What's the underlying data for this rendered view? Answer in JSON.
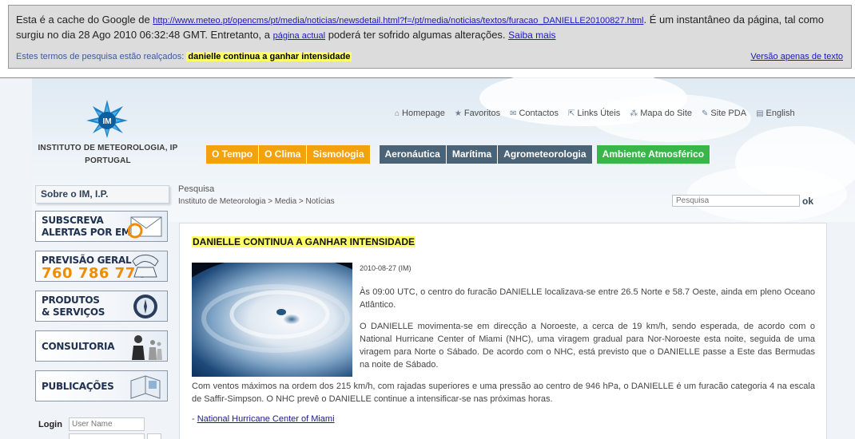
{
  "cache_banner": {
    "intro": "Esta é a cache do Google de ",
    "url": "http://www.meteo.pt/opencms/pt/media/noticias/newsdetail.html?f=/pt/media/noticias/textos/furacao_DANIELLE20100827.html",
    "text_after_url": ". É um instantâneo da página, tal como surgiu no dia 28 Ago 2010 06:32:48 GMT. Entretanto, a ",
    "current_page_link": "página actual",
    "text_after_link": " poderá ter sofrido algumas alterações. ",
    "learn_more": "Saiba mais",
    "terms_label": "Estes termos de pesquisa estão realçados: ",
    "terms_highlight": "danielle continua a ganhar intensidade",
    "text_only": "Versão apenas de texto"
  },
  "header": {
    "logo_abbr": "IM",
    "org_line1": "INSTITUTO DE METEOROLOGIA, IP",
    "org_line2": "PORTUGAL"
  },
  "top_links": [
    {
      "label": "Homepage",
      "icon": "⌂"
    },
    {
      "label": "Favoritos",
      "icon": "★"
    },
    {
      "label": "Contactos",
      "icon": "✉"
    },
    {
      "label": "Links Úteis",
      "icon": "⇱"
    },
    {
      "label": "Mapa do Site",
      "icon": "⁂"
    },
    {
      "label": "Site PDA",
      "icon": "✎"
    },
    {
      "label": "English",
      "icon": "▤"
    }
  ],
  "nav": {
    "tempo": "O Tempo",
    "clima": "O Clima",
    "sismologia": "Sismologia",
    "aeronautica": "Aeronáutica",
    "maritima": "Marítima",
    "agrometeorologia": "Agrometeorologia",
    "ambiente": "Ambiente Atmosférico"
  },
  "sidebar": {
    "about": "Sobre o IM, I.P.",
    "alerts_l1": "SUBSCREVA",
    "alerts_l2": "ALERTAS POR EMAIL",
    "forecast_l1": "PREVISÃO GERAL",
    "forecast_num": "760 786 774",
    "products_l1": "PRODUTOS",
    "products_l2": "& SERVIÇOS",
    "consulting": "CONSULTORIA",
    "publications": "PUBLICAÇÕES",
    "login_label": "Login",
    "user_placeholder": "User Name"
  },
  "content": {
    "section": "Pesquisa",
    "breadcrumb": "Instituto de Meteorologia > Media > Notícias",
    "search_placeholder": "Pesquisa",
    "search_ok": "ok",
    "title": "DANIELLE CONTINUA A GANHAR INTENSIDADE",
    "date": "2010-08-27 (IM)",
    "para1": "Às 09:00 UTC, o centro do furacão DANIELLE localizava-se entre 26.5 Norte e 58.7 Oeste, ainda em pleno Oceano Atlântico.",
    "para2": "O DANIELLE movimenta-se em direcção a Noroeste, a cerca de 19 km/h, sendo esperada, de acordo com o National Hurricane Center of Miami (NHC), uma viragem gradual para Nor-Noroeste esta noite, seguida de uma viragem para Norte o Sábado. De acordo com o NHC, está previsto que o DANIELLE passe a Este das Bermudas na noite de Sábado.",
    "para3": "Com ventos máximos na ordem dos 215 km/h, com rajadas superiores e uma pressão ao centro de 946 hPa, o DANIELLE é um furacão categoria 4 na escala de Saffir-Simpson. O NHC prevê o DANIELLE continue a intensificar-se nas próximas horas.",
    "ref_prefix": "- ",
    "ref_link": "National Hurricane Center of Miami"
  }
}
